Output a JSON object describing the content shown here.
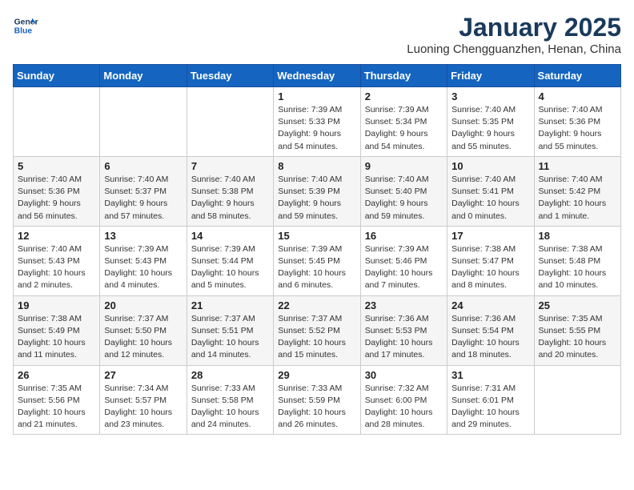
{
  "header": {
    "logo_line1": "General",
    "logo_line2": "Blue",
    "month_title": "January 2025",
    "location": "Luoning Chengguanzhen, Henan, China"
  },
  "weekdays": [
    "Sunday",
    "Monday",
    "Tuesday",
    "Wednesday",
    "Thursday",
    "Friday",
    "Saturday"
  ],
  "weeks": [
    [
      {
        "day": "",
        "info": ""
      },
      {
        "day": "",
        "info": ""
      },
      {
        "day": "",
        "info": ""
      },
      {
        "day": "1",
        "info": "Sunrise: 7:39 AM\nSunset: 5:33 PM\nDaylight: 9 hours\nand 54 minutes."
      },
      {
        "day": "2",
        "info": "Sunrise: 7:39 AM\nSunset: 5:34 PM\nDaylight: 9 hours\nand 54 minutes."
      },
      {
        "day": "3",
        "info": "Sunrise: 7:40 AM\nSunset: 5:35 PM\nDaylight: 9 hours\nand 55 minutes."
      },
      {
        "day": "4",
        "info": "Sunrise: 7:40 AM\nSunset: 5:36 PM\nDaylight: 9 hours\nand 55 minutes."
      }
    ],
    [
      {
        "day": "5",
        "info": "Sunrise: 7:40 AM\nSunset: 5:36 PM\nDaylight: 9 hours\nand 56 minutes."
      },
      {
        "day": "6",
        "info": "Sunrise: 7:40 AM\nSunset: 5:37 PM\nDaylight: 9 hours\nand 57 minutes."
      },
      {
        "day": "7",
        "info": "Sunrise: 7:40 AM\nSunset: 5:38 PM\nDaylight: 9 hours\nand 58 minutes."
      },
      {
        "day": "8",
        "info": "Sunrise: 7:40 AM\nSunset: 5:39 PM\nDaylight: 9 hours\nand 59 minutes."
      },
      {
        "day": "9",
        "info": "Sunrise: 7:40 AM\nSunset: 5:40 PM\nDaylight: 9 hours\nand 59 minutes."
      },
      {
        "day": "10",
        "info": "Sunrise: 7:40 AM\nSunset: 5:41 PM\nDaylight: 10 hours\nand 0 minutes."
      },
      {
        "day": "11",
        "info": "Sunrise: 7:40 AM\nSunset: 5:42 PM\nDaylight: 10 hours\nand 1 minute."
      }
    ],
    [
      {
        "day": "12",
        "info": "Sunrise: 7:40 AM\nSunset: 5:43 PM\nDaylight: 10 hours\nand 2 minutes."
      },
      {
        "day": "13",
        "info": "Sunrise: 7:39 AM\nSunset: 5:43 PM\nDaylight: 10 hours\nand 4 minutes."
      },
      {
        "day": "14",
        "info": "Sunrise: 7:39 AM\nSunset: 5:44 PM\nDaylight: 10 hours\nand 5 minutes."
      },
      {
        "day": "15",
        "info": "Sunrise: 7:39 AM\nSunset: 5:45 PM\nDaylight: 10 hours\nand 6 minutes."
      },
      {
        "day": "16",
        "info": "Sunrise: 7:39 AM\nSunset: 5:46 PM\nDaylight: 10 hours\nand 7 minutes."
      },
      {
        "day": "17",
        "info": "Sunrise: 7:38 AM\nSunset: 5:47 PM\nDaylight: 10 hours\nand 8 minutes."
      },
      {
        "day": "18",
        "info": "Sunrise: 7:38 AM\nSunset: 5:48 PM\nDaylight: 10 hours\nand 10 minutes."
      }
    ],
    [
      {
        "day": "19",
        "info": "Sunrise: 7:38 AM\nSunset: 5:49 PM\nDaylight: 10 hours\nand 11 minutes."
      },
      {
        "day": "20",
        "info": "Sunrise: 7:37 AM\nSunset: 5:50 PM\nDaylight: 10 hours\nand 12 minutes."
      },
      {
        "day": "21",
        "info": "Sunrise: 7:37 AM\nSunset: 5:51 PM\nDaylight: 10 hours\nand 14 minutes."
      },
      {
        "day": "22",
        "info": "Sunrise: 7:37 AM\nSunset: 5:52 PM\nDaylight: 10 hours\nand 15 minutes."
      },
      {
        "day": "23",
        "info": "Sunrise: 7:36 AM\nSunset: 5:53 PM\nDaylight: 10 hours\nand 17 minutes."
      },
      {
        "day": "24",
        "info": "Sunrise: 7:36 AM\nSunset: 5:54 PM\nDaylight: 10 hours\nand 18 minutes."
      },
      {
        "day": "25",
        "info": "Sunrise: 7:35 AM\nSunset: 5:55 PM\nDaylight: 10 hours\nand 20 minutes."
      }
    ],
    [
      {
        "day": "26",
        "info": "Sunrise: 7:35 AM\nSunset: 5:56 PM\nDaylight: 10 hours\nand 21 minutes."
      },
      {
        "day": "27",
        "info": "Sunrise: 7:34 AM\nSunset: 5:57 PM\nDaylight: 10 hours\nand 23 minutes."
      },
      {
        "day": "28",
        "info": "Sunrise: 7:33 AM\nSunset: 5:58 PM\nDaylight: 10 hours\nand 24 minutes."
      },
      {
        "day": "29",
        "info": "Sunrise: 7:33 AM\nSunset: 5:59 PM\nDaylight: 10 hours\nand 26 minutes."
      },
      {
        "day": "30",
        "info": "Sunrise: 7:32 AM\nSunset: 6:00 PM\nDaylight: 10 hours\nand 28 minutes."
      },
      {
        "day": "31",
        "info": "Sunrise: 7:31 AM\nSunset: 6:01 PM\nDaylight: 10 hours\nand 29 minutes."
      },
      {
        "day": "",
        "info": ""
      }
    ]
  ]
}
